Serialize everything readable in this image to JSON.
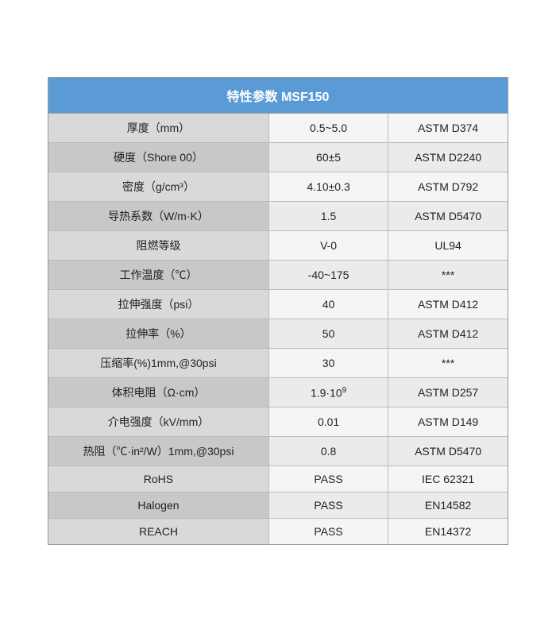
{
  "header": {
    "title": "特性参数 MSF150"
  },
  "rows": [
    {
      "property": "厚度（mm）",
      "value": "0.5~5.0",
      "standard": "ASTM D374"
    },
    {
      "property": "硬度（Shore 00）",
      "value": "60±5",
      "standard": "ASTM D2240"
    },
    {
      "property": "密度（g/cm³）",
      "value": "4.10±0.3",
      "standard": "ASTM D792"
    },
    {
      "property": "导热系数（W/m·K）",
      "value": "1.5",
      "standard": "ASTM D5470"
    },
    {
      "property": "阻燃等级",
      "value": "V-0",
      "standard": "UL94"
    },
    {
      "property": "工作温度（℃）",
      "value": "-40~175",
      "standard": "***"
    },
    {
      "property": "拉伸强度（psi）",
      "value": "40",
      "standard": "ASTM D412"
    },
    {
      "property": "拉伸率（%）",
      "value": "50",
      "standard": "ASTM D412"
    },
    {
      "property": "压缩率(%)1mm,@30psi",
      "value": "30",
      "standard": "***"
    },
    {
      "property": "体积电阻（Ω·cm）",
      "value": "1.9·10⁹",
      "standard": "ASTM D257"
    },
    {
      "property": "介电强度（kV/mm）",
      "value": "0.01",
      "standard": "ASTM D149"
    },
    {
      "property": "热阻（℃·in²/W）1mm,@30psi",
      "value": "0.8",
      "standard": "ASTM D5470"
    },
    {
      "property": "RoHS",
      "value": "PASS",
      "standard": "IEC 62321"
    },
    {
      "property": "Halogen",
      "value": "PASS",
      "standard": "EN14582"
    },
    {
      "property": "REACH",
      "value": "PASS",
      "standard": "EN14372"
    }
  ]
}
